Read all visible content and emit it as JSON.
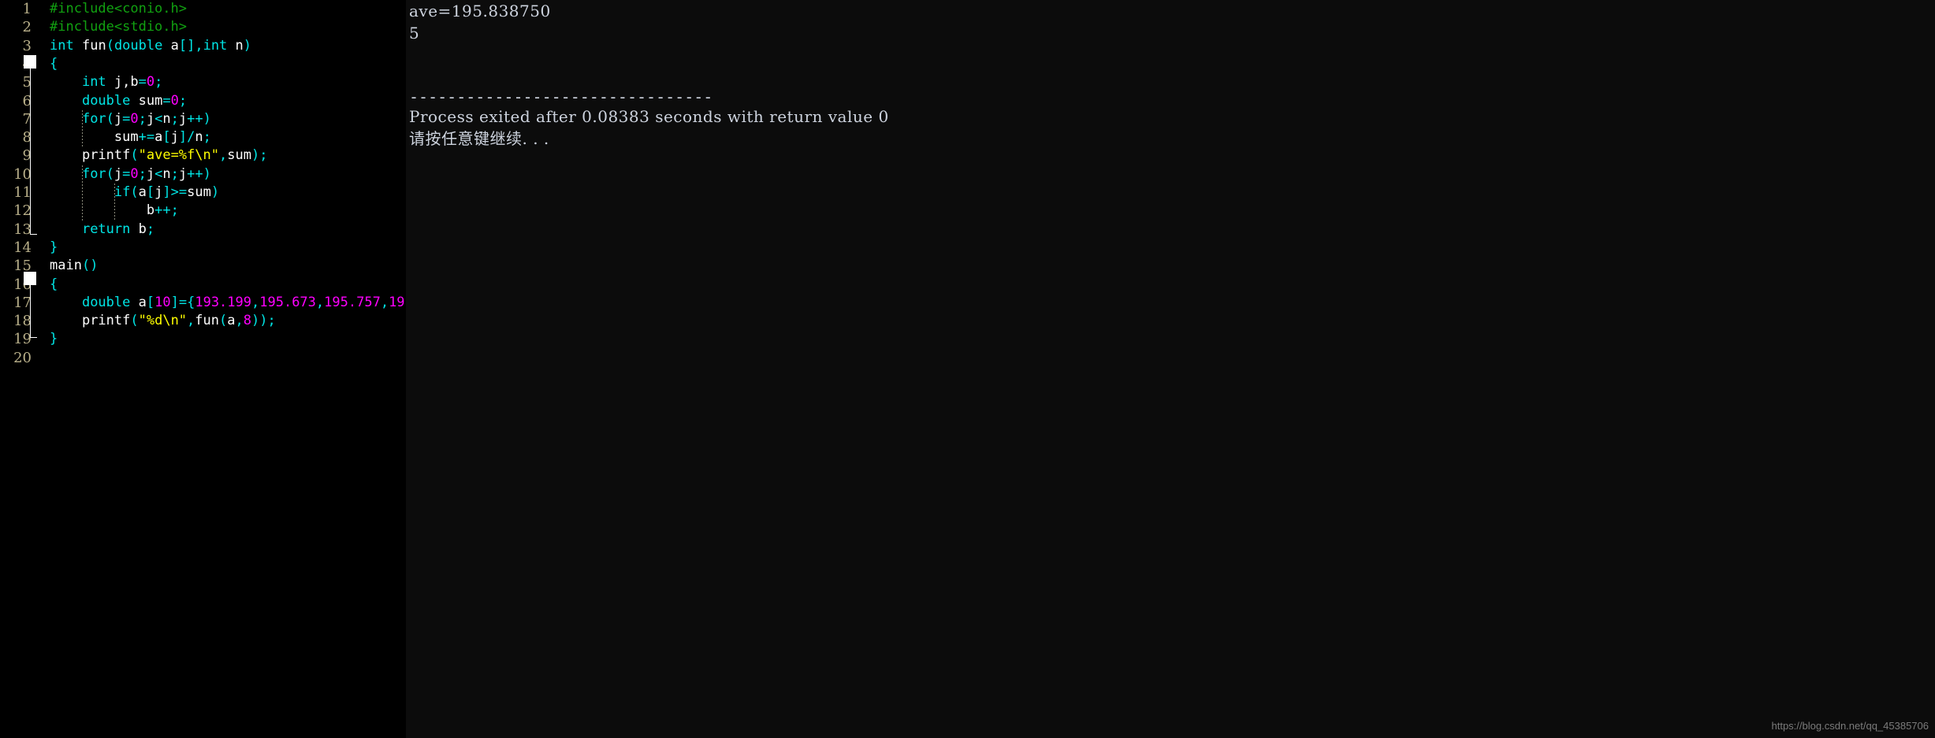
{
  "editor": {
    "pane_background": "#000000",
    "gutter_color": "#b9b08a",
    "total_lines": 20,
    "lines": [
      {
        "num": "1",
        "tokens": [
          {
            "t": "#include<conio.h>",
            "c": "t-pre"
          }
        ]
      },
      {
        "num": "2",
        "tokens": [
          {
            "t": "#include<stdio.h>",
            "c": "t-pre"
          }
        ]
      },
      {
        "num": "3",
        "tokens": [
          {
            "t": "int",
            "c": "t-kw"
          },
          {
            "t": " ",
            "c": "t-plain"
          },
          {
            "t": "fun",
            "c": "t-id"
          },
          {
            "t": "(",
            "c": "t-op"
          },
          {
            "t": "double",
            "c": "t-kw"
          },
          {
            "t": " a",
            "c": "t-id"
          },
          {
            "t": "[]",
            "c": "t-op"
          },
          {
            "t": ",",
            "c": "t-op"
          },
          {
            "t": "int",
            "c": "t-kw"
          },
          {
            "t": " n",
            "c": "t-id"
          },
          {
            "t": ")",
            "c": "t-op"
          }
        ]
      },
      {
        "num": "4",
        "tokens": [
          {
            "t": "{",
            "c": "t-op"
          }
        ]
      },
      {
        "num": "5",
        "tokens": [
          {
            "t": "    ",
            "c": "t-plain"
          },
          {
            "t": "int",
            "c": "t-kw"
          },
          {
            "t": " j,b",
            "c": "t-id"
          },
          {
            "t": "=",
            "c": "t-op"
          },
          {
            "t": "0",
            "c": "t-num"
          },
          {
            "t": ";",
            "c": "t-op"
          }
        ]
      },
      {
        "num": "6",
        "tokens": [
          {
            "t": "    ",
            "c": "t-plain"
          },
          {
            "t": "double",
            "c": "t-kw"
          },
          {
            "t": " sum",
            "c": "t-id"
          },
          {
            "t": "=",
            "c": "t-op"
          },
          {
            "t": "0",
            "c": "t-num"
          },
          {
            "t": ";",
            "c": "t-op"
          }
        ]
      },
      {
        "num": "7",
        "tokens": [
          {
            "t": "    ",
            "c": "t-plain"
          },
          {
            "t": "for",
            "c": "t-kw"
          },
          {
            "t": "(",
            "c": "t-op"
          },
          {
            "t": "j",
            "c": "t-id"
          },
          {
            "t": "=",
            "c": "t-op"
          },
          {
            "t": "0",
            "c": "t-num"
          },
          {
            "t": ";",
            "c": "t-op"
          },
          {
            "t": "j",
            "c": "t-id"
          },
          {
            "t": "<",
            "c": "t-op"
          },
          {
            "t": "n",
            "c": "t-id"
          },
          {
            "t": ";",
            "c": "t-op"
          },
          {
            "t": "j",
            "c": "t-id"
          },
          {
            "t": "++",
            "c": "t-op"
          },
          {
            "t": ")",
            "c": "t-op"
          }
        ]
      },
      {
        "num": "8",
        "tokens": [
          {
            "t": "        ",
            "c": "t-plain"
          },
          {
            "t": "sum",
            "c": "t-id"
          },
          {
            "t": "+=",
            "c": "t-op"
          },
          {
            "t": "a",
            "c": "t-id"
          },
          {
            "t": "[",
            "c": "t-op"
          },
          {
            "t": "j",
            "c": "t-id"
          },
          {
            "t": "]",
            "c": "t-op"
          },
          {
            "t": "/",
            "c": "t-op"
          },
          {
            "t": "n",
            "c": "t-id"
          },
          {
            "t": ";",
            "c": "t-op"
          }
        ]
      },
      {
        "num": "9",
        "tokens": [
          {
            "t": "    ",
            "c": "t-plain"
          },
          {
            "t": "printf",
            "c": "t-id"
          },
          {
            "t": "(",
            "c": "t-op"
          },
          {
            "t": "\"ave=%f\\n\"",
            "c": "t-str"
          },
          {
            "t": ",",
            "c": "t-op"
          },
          {
            "t": "sum",
            "c": "t-id"
          },
          {
            "t": ")",
            "c": "t-op"
          },
          {
            "t": ";",
            "c": "t-op"
          }
        ]
      },
      {
        "num": "10",
        "tokens": [
          {
            "t": "    ",
            "c": "t-plain"
          },
          {
            "t": "for",
            "c": "t-kw"
          },
          {
            "t": "(",
            "c": "t-op"
          },
          {
            "t": "j",
            "c": "t-id"
          },
          {
            "t": "=",
            "c": "t-op"
          },
          {
            "t": "0",
            "c": "t-num"
          },
          {
            "t": ";",
            "c": "t-op"
          },
          {
            "t": "j",
            "c": "t-id"
          },
          {
            "t": "<",
            "c": "t-op"
          },
          {
            "t": "n",
            "c": "t-id"
          },
          {
            "t": ";",
            "c": "t-op"
          },
          {
            "t": "j",
            "c": "t-id"
          },
          {
            "t": "++",
            "c": "t-op"
          },
          {
            "t": ")",
            "c": "t-op"
          }
        ]
      },
      {
        "num": "11",
        "tokens": [
          {
            "t": "        ",
            "c": "t-plain"
          },
          {
            "t": "if",
            "c": "t-kw"
          },
          {
            "t": "(",
            "c": "t-op"
          },
          {
            "t": "a",
            "c": "t-id"
          },
          {
            "t": "[",
            "c": "t-op"
          },
          {
            "t": "j",
            "c": "t-id"
          },
          {
            "t": "]",
            "c": "t-op"
          },
          {
            "t": ">=",
            "c": "t-op"
          },
          {
            "t": "sum",
            "c": "t-id"
          },
          {
            "t": ")",
            "c": "t-op"
          }
        ]
      },
      {
        "num": "12",
        "tokens": [
          {
            "t": "            ",
            "c": "t-plain"
          },
          {
            "t": "b",
            "c": "t-id"
          },
          {
            "t": "++",
            "c": "t-op"
          },
          {
            "t": ";",
            "c": "t-op"
          }
        ]
      },
      {
        "num": "13",
        "tokens": [
          {
            "t": "    ",
            "c": "t-plain"
          },
          {
            "t": "return",
            "c": "t-kw"
          },
          {
            "t": " b",
            "c": "t-id"
          },
          {
            "t": ";",
            "c": "t-op"
          }
        ]
      },
      {
        "num": "14",
        "tokens": [
          {
            "t": "}",
            "c": "t-op"
          }
        ]
      },
      {
        "num": "15",
        "tokens": [
          {
            "t": "main",
            "c": "t-id"
          },
          {
            "t": "()",
            "c": "t-op"
          }
        ]
      },
      {
        "num": "16",
        "tokens": [
          {
            "t": "{",
            "c": "t-op"
          }
        ]
      },
      {
        "num": "17",
        "tokens": [
          {
            "t": "    ",
            "c": "t-plain"
          },
          {
            "t": "double",
            "c": "t-kw"
          },
          {
            "t": " a",
            "c": "t-id"
          },
          {
            "t": "[",
            "c": "t-op"
          },
          {
            "t": "10",
            "c": "t-num"
          },
          {
            "t": "]",
            "c": "t-op"
          },
          {
            "t": "=",
            "c": "t-op"
          },
          {
            "t": "{",
            "c": "t-op"
          },
          {
            "t": "193.199",
            "c": "t-num"
          },
          {
            "t": ",",
            "c": "t-op"
          },
          {
            "t": "195.673",
            "c": "t-num"
          },
          {
            "t": ",",
            "c": "t-op"
          },
          {
            "t": "195.757",
            "c": "t-num"
          },
          {
            "t": ",",
            "c": "t-op"
          },
          {
            "t": "19",
            "c": "t-num"
          }
        ]
      },
      {
        "num": "18",
        "tokens": [
          {
            "t": "    ",
            "c": "t-plain"
          },
          {
            "t": "printf",
            "c": "t-id"
          },
          {
            "t": "(",
            "c": "t-op"
          },
          {
            "t": "\"%d\\n\"",
            "c": "t-str"
          },
          {
            "t": ",",
            "c": "t-op"
          },
          {
            "t": "fun",
            "c": "t-id"
          },
          {
            "t": "(",
            "c": "t-op"
          },
          {
            "t": "a",
            "c": "t-id"
          },
          {
            "t": ",",
            "c": "t-op"
          },
          {
            "t": "8",
            "c": "t-num"
          },
          {
            "t": ")",
            "c": "t-op"
          },
          {
            "t": ")",
            "c": "t-op"
          },
          {
            "t": ";",
            "c": "t-op"
          }
        ]
      },
      {
        "num": "19",
        "tokens": [
          {
            "t": "}",
            "c": "t-op"
          }
        ]
      },
      {
        "num": "20",
        "tokens": []
      }
    ]
  },
  "console": {
    "background": "#0c0c0c",
    "lines": [
      "ave=195.838750",
      "5",
      "",
      "",
      "--------------------------------",
      "Process exited after 0.08383 seconds with return value 0",
      "请按任意键继续. . ."
    ],
    "program_output_average": "ave=195.838750",
    "program_output_count": "5",
    "separator_rule": "--------------------------------",
    "exit_message": "Process exited after 0.08383 seconds with return value 0",
    "press_any_key": "请按任意键继续. . .",
    "exit_seconds": "0.08383",
    "return_value": "0"
  },
  "watermark": {
    "text": "https://blog.csdn.net/qq_45385706"
  }
}
